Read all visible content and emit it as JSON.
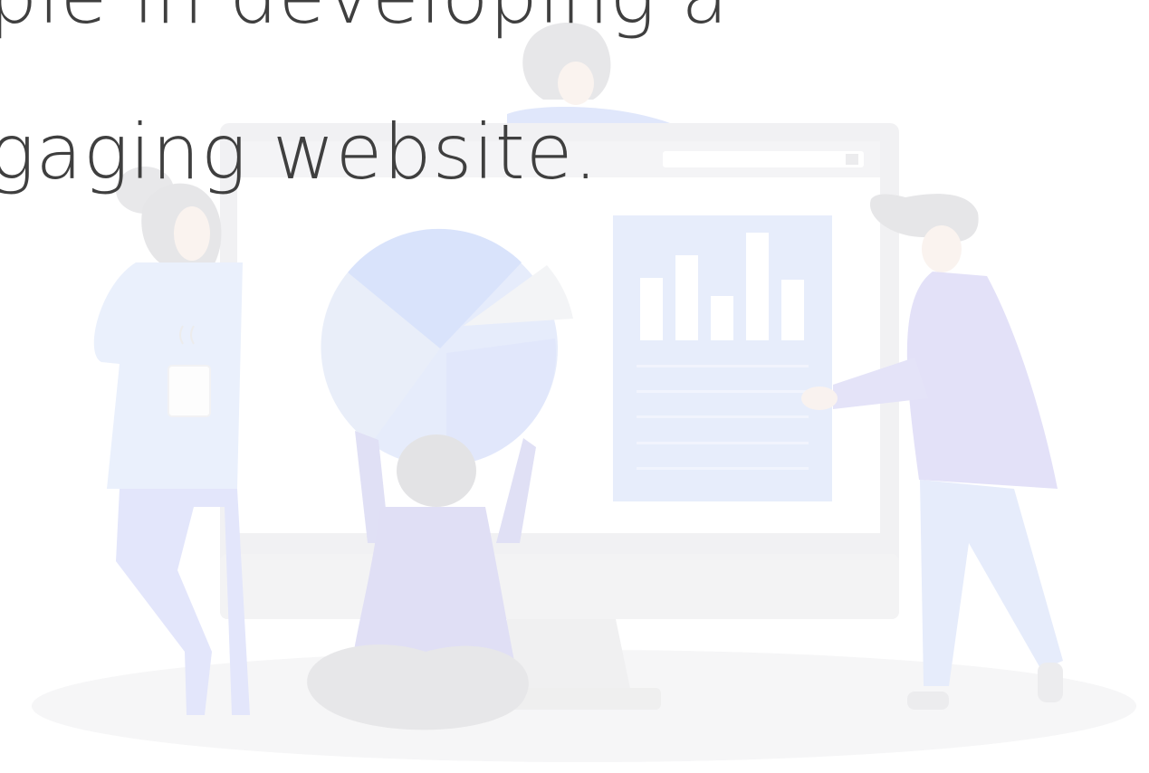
{
  "hero": {
    "heading_line_1": "ple in developing a",
    "heading_line_2": "gaging website."
  },
  "illustration": {
    "name": "team-analytics-illustration",
    "colors": {
      "monitor": "#f1f1f3",
      "screen": "#ffffff",
      "accent_blue": "#dfe6fb",
      "accent_purple": "#e2e1f7",
      "hair_gray": "#e5e5e7",
      "skin": "#faf3ef",
      "ground": "#f6f6f7"
    }
  }
}
